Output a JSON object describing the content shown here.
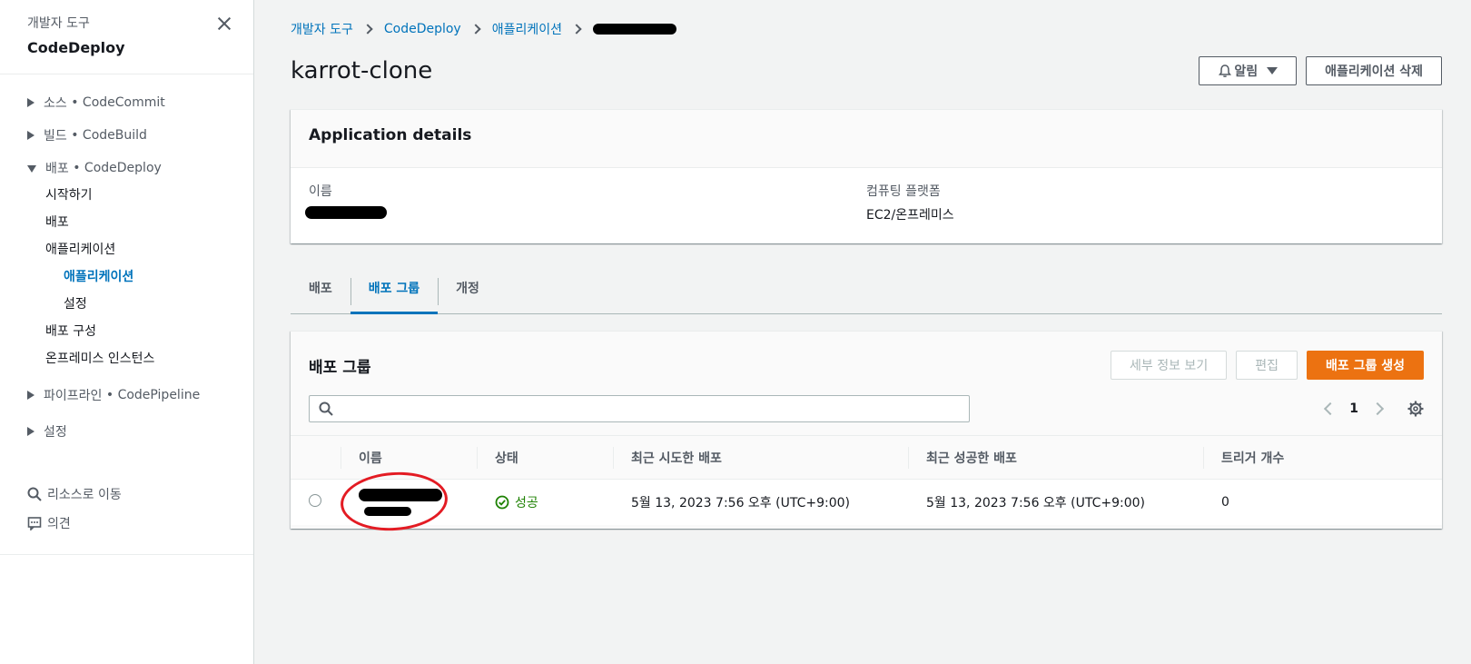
{
  "sidebar": {
    "supertitle": "개발자 도구",
    "title": "CodeDeploy",
    "sections": [
      {
        "name": "소스",
        "service": "• CodeCommit"
      },
      {
        "name": "빌드",
        "service": "• CodeBuild"
      },
      {
        "name": "배포",
        "service": "• CodeDeploy"
      }
    ],
    "deploy_items": [
      "시작하기",
      "배포",
      "애플리케이션"
    ],
    "app_items": [
      "애플리케이션",
      "설정"
    ],
    "deploy_items2": [
      "배포 구성",
      "온프레미스 인스턴스"
    ],
    "pipeline": {
      "name": "파이프라인",
      "service": "• CodePipeline"
    },
    "settings": "설정",
    "tools": {
      "go_resource": "리소스로 이동",
      "feedback": "의견"
    }
  },
  "breadcrumb": [
    "개발자 도구",
    "CodeDeploy",
    "애플리케이션"
  ],
  "page": {
    "title": "karrot-clone",
    "notify_label": "알림",
    "delete_label": "애플리케이션 삭제"
  },
  "details": {
    "title": "Application details",
    "name_label": "이름",
    "platform_label": "컴퓨팅 플랫폼",
    "platform_value": "EC2/온프레미스"
  },
  "tabs": [
    "배포",
    "배포 그룹",
    "개정"
  ],
  "groups": {
    "title": "배포 그룹",
    "view_details": "세부 정보 보기",
    "edit": "편집",
    "create": "배포 그룹 생성",
    "page": "1",
    "columns": [
      "이름",
      "상태",
      "최근 시도한 배포",
      "최근 성공한 배포",
      "트리거 개수"
    ],
    "rows": [
      {
        "status": "성공",
        "last_attempt": "5월 13, 2023 7:56 오후 (UTC+9:00)",
        "last_success": "5월 13, 2023 7:56 오후 (UTC+9:00)",
        "triggers": "0"
      }
    ]
  },
  "colors": {
    "link": "#0073bb",
    "primary": "#ec7211",
    "success": "#1d8102",
    "annotation": "#e31b23"
  }
}
